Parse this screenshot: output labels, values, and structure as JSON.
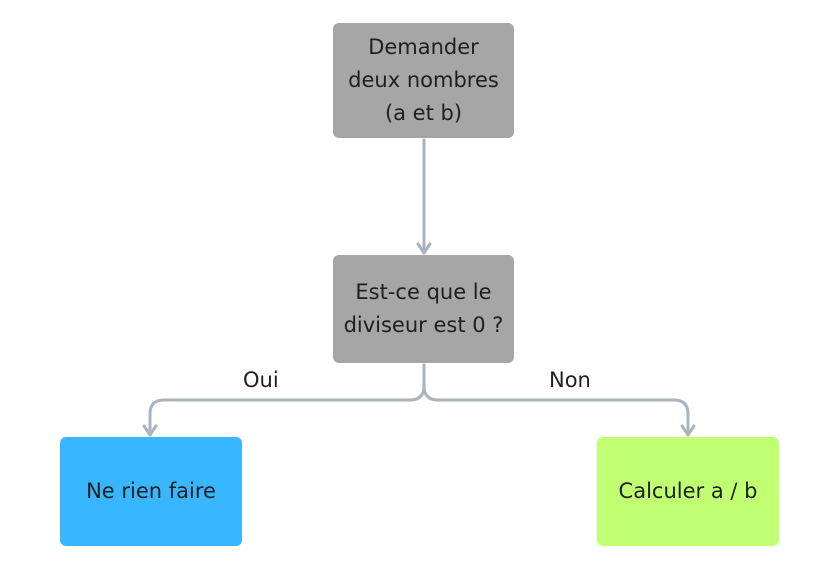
{
  "nodes": {
    "input": {
      "lines": [
        "Demander",
        "deux nombres",
        "(a et b)"
      ],
      "color": "#a6a6a6"
    },
    "decision": {
      "lines": [
        "Est-ce que le",
        "diviseur est 0 ?"
      ],
      "color": "#a6a6a6"
    },
    "yes": {
      "lines": [
        "Ne rien faire"
      ],
      "color": "#38b6ff"
    },
    "no": {
      "lines": [
        "Calculer a / b"
      ],
      "color": "#c1ff72"
    }
  },
  "edges": {
    "yes_label": "Oui",
    "no_label": "Non",
    "connector_color": "#a9b4be"
  }
}
